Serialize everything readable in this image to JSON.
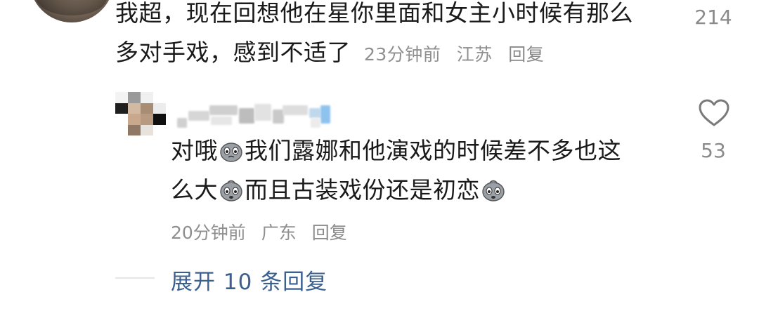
{
  "top_comment": {
    "text_line1": "我超，现在回想他在星你里面和女主小时候有那么",
    "text_line2": "多对手戏，感到不适了",
    "time": "23分钟前",
    "location": "江苏",
    "reply_label": "回复",
    "like_count": "214"
  },
  "reply_comment": {
    "text_part1": "对哦",
    "text_part2": "我们露娜和他演戏的时候差不多也这",
    "text_part3": "么大",
    "text_part4": "而且古装戏份还是初恋",
    "emoji_name": "worried-face-emoji",
    "time": "20分钟前",
    "location": "广东",
    "reply_label": "回复",
    "like_count": "53",
    "like_icon": "heart-outline-icon"
  },
  "expand_replies": {
    "label": "展开 10 条回复"
  },
  "colors": {
    "text": "#1a1a1a",
    "meta": "#8f8f8f",
    "link": "#3b5f8f"
  }
}
